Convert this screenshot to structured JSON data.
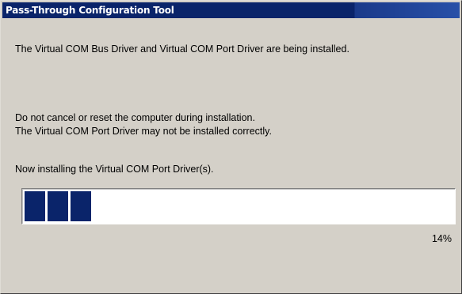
{
  "window": {
    "title": "Pass-Through Configuration Tool"
  },
  "messages": {
    "installing": "The Virtual COM Bus Driver and Virtual COM Port Driver are being installed.",
    "warning_line1": "Do not cancel or reset the computer during installation.",
    "warning_line2": "The Virtual COM Port Driver may not be installed correctly.",
    "status": "Now installing the Virtual COM Port Driver(s)."
  },
  "progress": {
    "percent_label": "14%",
    "value": 0.14
  },
  "colors": {
    "titlebar": "#0a246a",
    "progress_block": "#0a246a",
    "window_face": "#d4d0c8"
  }
}
